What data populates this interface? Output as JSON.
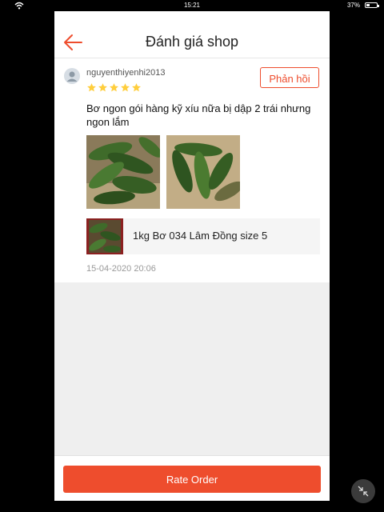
{
  "status_bar": {
    "time": "15:21",
    "battery": "37%",
    "battery_level": 0.37
  },
  "header": {
    "title": "Đánh giá shop",
    "back_icon": "back-arrow-icon"
  },
  "review": {
    "username": "nguyenthiyenhi2013",
    "rating": 5,
    "rating_max": 5,
    "reply_label": "Phản hồi",
    "text": "Bơ ngon gói hàng kỹ xíu nữa bị dập 2 trái nhưng ngon lắm",
    "product_name": "1kg Bơ 034 Lâm Đồng size 5",
    "timestamp": "15-04-2020 20:06"
  },
  "footer": {
    "rate_order_label": "Rate Order"
  },
  "colors": {
    "accent": "#ee4d2d",
    "star": "#ffce3d",
    "avocado": "#3f6b2a",
    "background": "#efefef"
  }
}
